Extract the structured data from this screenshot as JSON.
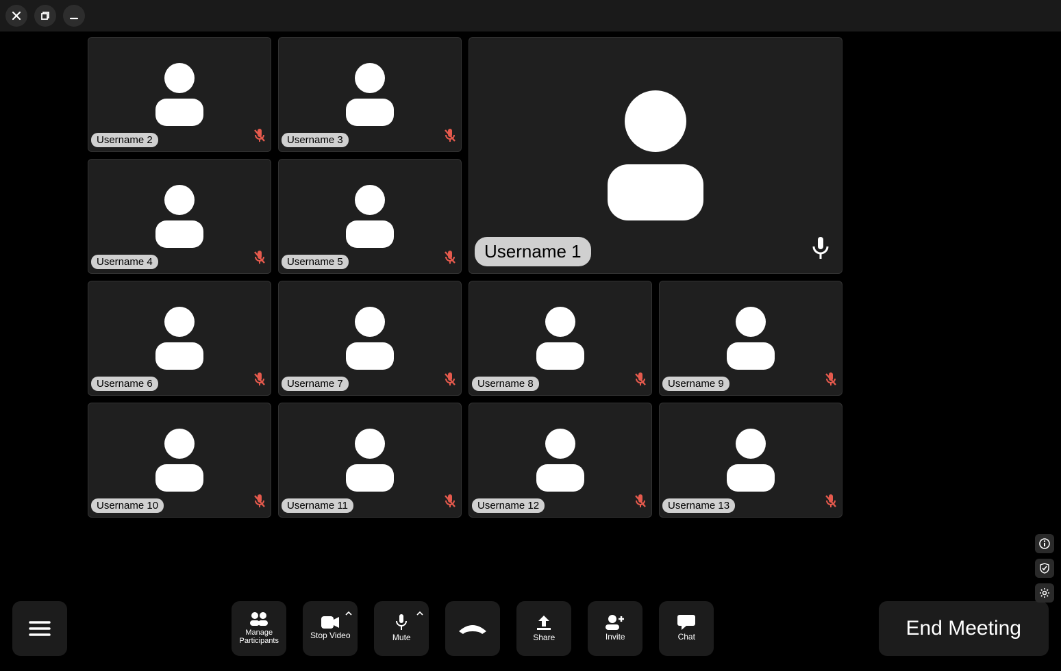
{
  "main_speaker": {
    "name": "Username 1",
    "muted": false
  },
  "participants_grid_a": [
    {
      "name": "Username 2",
      "muted": true
    },
    {
      "name": "Username 3",
      "muted": true
    },
    {
      "name": "Username 4",
      "muted": true
    },
    {
      "name": "Username 5",
      "muted": true
    }
  ],
  "participants_grid_b": [
    {
      "name": "Username 6",
      "muted": true
    },
    {
      "name": "Username 7",
      "muted": true
    },
    {
      "name": "Username 8",
      "muted": true
    },
    {
      "name": "Username 9",
      "muted": true
    },
    {
      "name": "Username 10",
      "muted": true
    },
    {
      "name": "Username 11",
      "muted": true
    },
    {
      "name": "Username 12",
      "muted": true
    },
    {
      "name": "Username 13",
      "muted": true
    }
  ],
  "toolbar": {
    "manage": "Manage\nParticipants",
    "stop_video": "Stop Video",
    "mute": "Mute",
    "share": "Share",
    "invite": "Invite",
    "chat": "Chat"
  },
  "end_label": "End Meeting",
  "colors": {
    "muted_mic": "#e55a4d"
  }
}
